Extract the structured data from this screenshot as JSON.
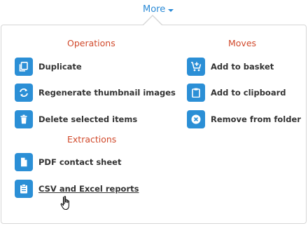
{
  "more_menu": {
    "label": "More"
  },
  "sections": {
    "operations": {
      "title": "Operations",
      "items": [
        {
          "label": "Duplicate",
          "icon": "duplicate-icon"
        },
        {
          "label": "Regenerate thumbnail images",
          "icon": "refresh-icon"
        },
        {
          "label": "Delete selected items",
          "icon": "trash-icon"
        }
      ]
    },
    "moves": {
      "title": "Moves",
      "items": [
        {
          "label": "Add to basket",
          "icon": "cart-add-icon"
        },
        {
          "label": "Add to clipboard",
          "icon": "clipboard-icon"
        },
        {
          "label": "Remove from folder",
          "icon": "remove-circle-icon"
        }
      ]
    },
    "extractions": {
      "title": "Extractions",
      "items": [
        {
          "label": "PDF contact sheet",
          "icon": "document-icon"
        },
        {
          "label": "CSV and Excel reports",
          "icon": "report-clipboard-icon"
        }
      ]
    }
  },
  "hovered_item": "CSV and Excel reports",
  "colors": {
    "accent": "#2a8ad6",
    "icon_tile": "#2b8fd6",
    "section_title": "#d1492b",
    "label": "#333333"
  }
}
